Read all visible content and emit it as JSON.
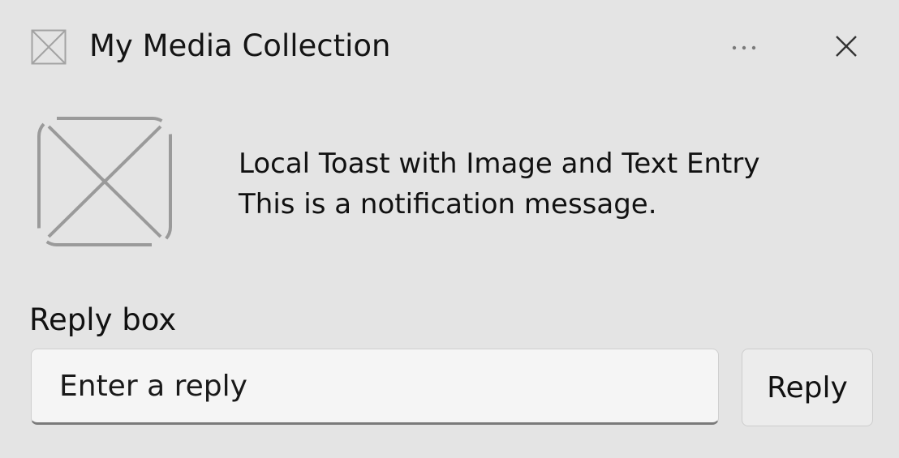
{
  "header": {
    "app_icon": "placeholder-image-icon",
    "title": "My Media Collection",
    "more_icon": "ellipsis-icon",
    "close_icon": "close-icon"
  },
  "content": {
    "hero_image_icon": "placeholder-image-icon",
    "title": "Local Toast with Image and Text Entry",
    "message": "This is a notification message."
  },
  "reply": {
    "label": "Reply box",
    "input_value": "",
    "placeholder": "Enter a reply",
    "button_label": "Reply"
  },
  "colors": {
    "background": "#e4e4e4",
    "input_background": "#f5f5f5",
    "icon_gray": "#9a9a9a"
  }
}
